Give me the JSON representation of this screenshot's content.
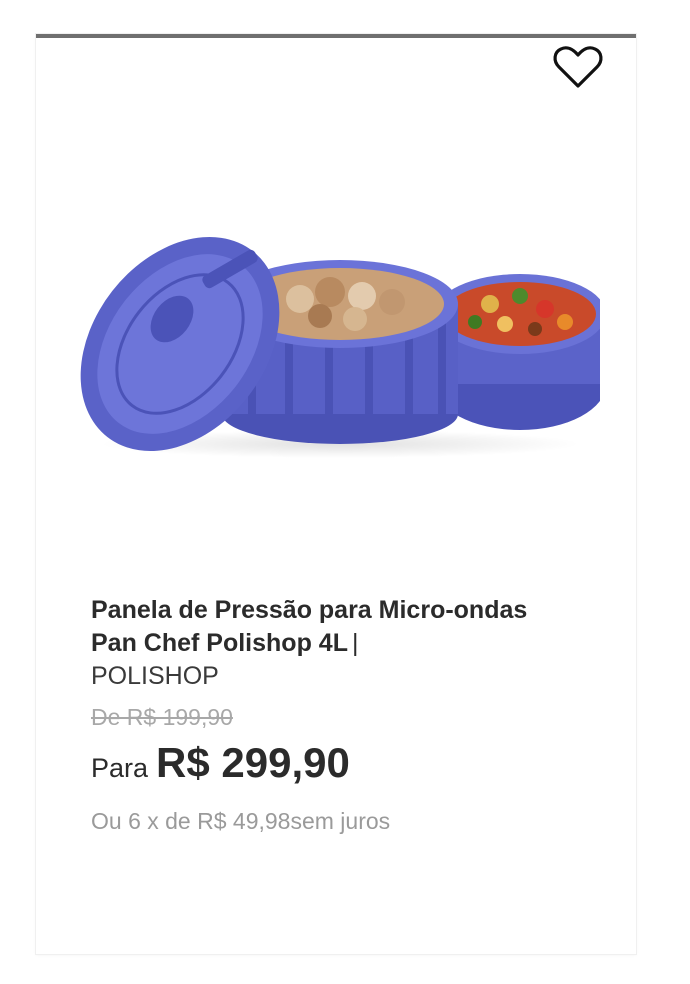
{
  "product": {
    "name": "Panela de Pressão para Micro-ondas Pan Chef Polishop 4L",
    "separator": "|",
    "brand": "POLISHOP",
    "image_icon": "product-image-pressure-cooker"
  },
  "pricing": {
    "old_price": "De R$ 199,90",
    "price_prefix": "Para",
    "price": "R$ 299,90",
    "installments": "Ou 6 x de R$ 49,98sem juros"
  },
  "wishlist": {
    "icon": "heart-icon"
  },
  "colors": {
    "top_bar": "#6f6f6f",
    "text_primary": "#2b2b2b",
    "text_muted": "#9a9a9a",
    "product_blue": "#5b63c9"
  }
}
